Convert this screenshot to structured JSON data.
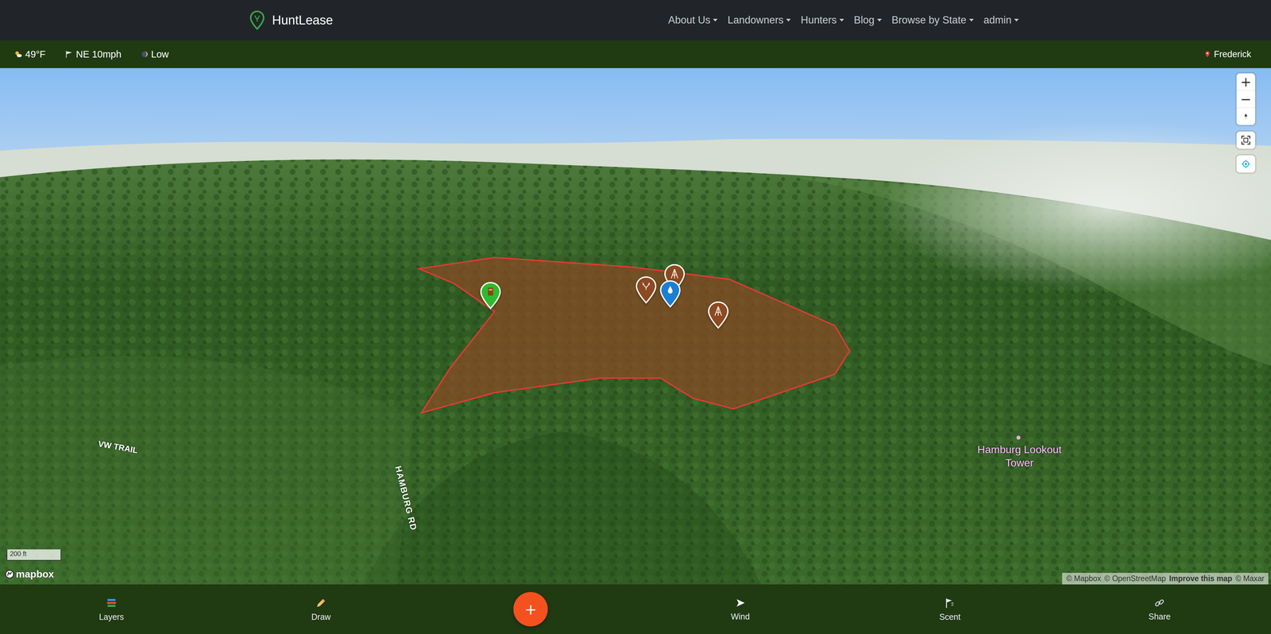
{
  "navbar": {
    "brand": "HuntLease",
    "items": [
      {
        "label": "About Us",
        "dropdown": true
      },
      {
        "label": "Landowners",
        "dropdown": true
      },
      {
        "label": "Hunters",
        "dropdown": true
      },
      {
        "label": "Blog",
        "dropdown": true
      },
      {
        "label": "Browse by State",
        "dropdown": true
      },
      {
        "label": "admin",
        "dropdown": true
      }
    ]
  },
  "conditions": {
    "temperature": "49°F",
    "wind": "NE 10mph",
    "moon": "Low",
    "location": "Frederick"
  },
  "map": {
    "zoom_in": "+",
    "zoom_out": "−",
    "scale": "200 ft",
    "logo": "mapbox",
    "attribution": [
      {
        "text": "© Mapbox",
        "bold": false
      },
      {
        "text": "© OpenStreetMap",
        "bold": false
      },
      {
        "text": "Improve this map",
        "bold": true
      },
      {
        "text": "© Maxar",
        "bold": false
      }
    ],
    "labels": [
      {
        "text": "VW TRAIL",
        "kind": "trail"
      },
      {
        "text": "HAMBURG RD",
        "kind": "road"
      },
      {
        "text": "Hamburg Lookout Tower",
        "kind": "poi"
      }
    ],
    "pins": [
      {
        "kind": "blind",
        "color": "#2dbb2d"
      },
      {
        "kind": "sighting",
        "color": "#8b4a22"
      },
      {
        "kind": "stand",
        "color": "#8b4a22"
      },
      {
        "kind": "water",
        "color": "#1a7fd4"
      },
      {
        "kind": "stand",
        "color": "#8b4a22"
      }
    ]
  },
  "toolbar": [
    {
      "label": "Layers",
      "kind": "layers"
    },
    {
      "label": "Draw",
      "kind": "draw"
    },
    {
      "label": "+",
      "kind": "add"
    },
    {
      "label": "Wind",
      "kind": "wind"
    },
    {
      "label": "Scent",
      "kind": "scent"
    },
    {
      "label": "Share",
      "kind": "share"
    }
  ]
}
